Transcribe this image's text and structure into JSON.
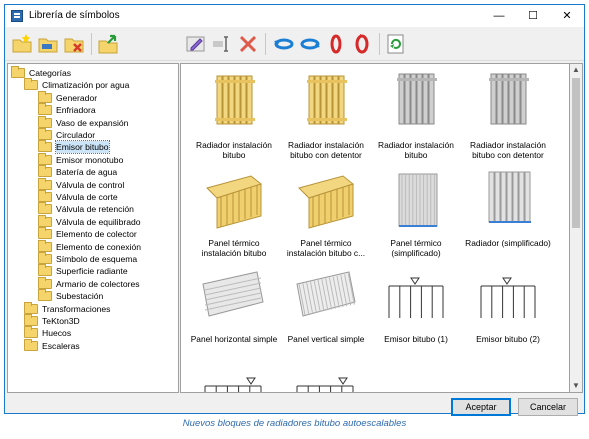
{
  "window": {
    "title": "Librería de símbolos",
    "controls": {
      "minimize": "—",
      "maximize": "☐",
      "close": "✕"
    }
  },
  "toolbar": {
    "icons": [
      "new-folder-icon",
      "open-folder-icon",
      "delete-folder-icon",
      "import-icon",
      "edit-icon",
      "rename-icon",
      "delete-icon",
      "rotate-left-icon",
      "rotate-right-icon",
      "flip-horizontal-icon",
      "flip-vertical-icon",
      "refresh-icon"
    ]
  },
  "tree": {
    "root": "Categorías",
    "group": "Climatización por agua",
    "children": [
      "Generador",
      "Enfriadora",
      "Vaso de expansión",
      "Circulador",
      "Emisor bitubo",
      "Emisor monotubo",
      "Batería de agua",
      "Válvula de control",
      "Válvula de corte",
      "Válvula de retención",
      "Válvula de equilibrado",
      "Elemento de colector",
      "Elemento de conexión",
      "Símbolo de esquema",
      "Superficie radiante",
      "Armario de colectores",
      "Subestación"
    ],
    "selected": "Emisor bitubo",
    "top_level": [
      "Transformaciones",
      "TeKton3D",
      "Huecos",
      "Escaleras"
    ]
  },
  "symbols": [
    {
      "caption_line1": "Radiador instalación",
      "caption_line2": "bitubo"
    },
    {
      "caption_line1": "Radiador instalación",
      "caption_line2": "bitubo con detentor"
    },
    {
      "caption_line1": "Radiador instalación",
      "caption_line2": "bitubo"
    },
    {
      "caption_line1": "Radiador instalación",
      "caption_line2": "bitubo con detentor"
    },
    {
      "caption_line1": "Panel térmico",
      "caption_line2": "instalación bitubo"
    },
    {
      "caption_line1": "Panel térmico",
      "caption_line2": "instalación bitubo c..."
    },
    {
      "caption_line1": "Panel térmico",
      "caption_line2": "(simplificado)"
    },
    {
      "caption_line1": "Radiador (simplificado)",
      "caption_line2": ""
    },
    {
      "caption_line1": "Panel horizontal simple",
      "caption_line2": ""
    },
    {
      "caption_line1": "Panel vertical simple",
      "caption_line2": ""
    },
    {
      "caption_line1": "Emisor bitubo (1)",
      "caption_line2": ""
    },
    {
      "caption_line1": "Emisor bitubo (2)",
      "caption_line2": ""
    }
  ],
  "buttons": {
    "accept": "Aceptar",
    "cancel": "Cancelar"
  },
  "figure_caption": "Nuevos bloques de radiadores bitubo autoescalables",
  "colors": {
    "accent": "#0078d7",
    "selection": "#cce4f7",
    "caption": "#2e6bb0"
  }
}
